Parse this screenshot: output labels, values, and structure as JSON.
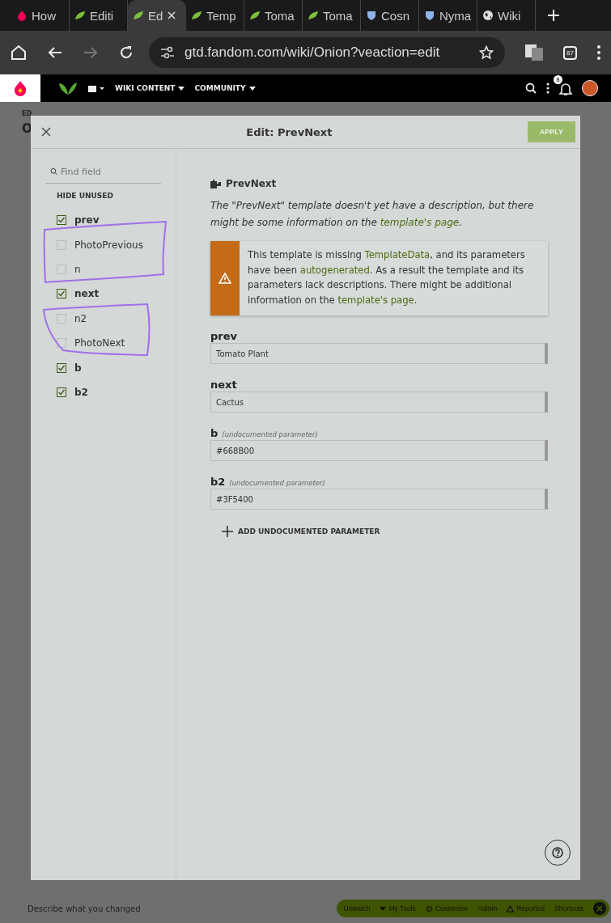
{
  "browser": {
    "tabs": [
      {
        "title": "How",
        "kind": "flame",
        "selected": false
      },
      {
        "title": "Editi",
        "kind": "leaf",
        "selected": false
      },
      {
        "title": "Ed",
        "kind": "leaf",
        "selected": true
      },
      {
        "title": "Temp",
        "kind": "leaf",
        "selected": false
      },
      {
        "title": "Toma",
        "kind": "leaf",
        "selected": false
      },
      {
        "title": "Toma",
        "kind": "leaf",
        "selected": false
      },
      {
        "title": "Cosn",
        "kind": "shield",
        "selected": false
      },
      {
        "title": "Nyma",
        "kind": "shield",
        "selected": false
      },
      {
        "title": "Wiki",
        "kind": "globe",
        "selected": false
      }
    ],
    "url": "gtd.fandom.com/wiki/Onion?veaction=edit",
    "extensions_badge": "87"
  },
  "site_nav": {
    "items": [
      "WIKI CONTENT",
      "COMMUNITY"
    ],
    "notification_count": "8"
  },
  "background_page": {
    "label": "ED",
    "heading": "O",
    "summary_placeholder": "Describe what you changed"
  },
  "dialog": {
    "title": "Edit: PrevNext",
    "apply": "APPLY",
    "sidebar": {
      "search_placeholder": "Find field",
      "hide_unused": "HIDE UNUSED",
      "fields": [
        {
          "label": "prev",
          "checked": true
        },
        {
          "label": "PhotoPrevious",
          "checked": false
        },
        {
          "label": "n",
          "checked": false
        },
        {
          "label": "next",
          "checked": true
        },
        {
          "label": "n2",
          "checked": false
        },
        {
          "label": "PhotoNext",
          "checked": false
        },
        {
          "label": "b",
          "checked": true
        },
        {
          "label": "b2",
          "checked": true
        }
      ]
    },
    "template": {
      "name": "PrevNext",
      "description": "The \"PrevNext\" template doesn't yet have a description, but there might be some information on the ",
      "description_link": "template's page",
      "description_end": "."
    },
    "notice": {
      "parts": [
        {
          "text": "This template is missing ",
          "link": false
        },
        {
          "text": "TemplateData",
          "link": true
        },
        {
          "text": ", and its parameters have been ",
          "link": false
        },
        {
          "text": "autogenerated",
          "link": true
        },
        {
          "text": ". As a result the template and its parameters lack descriptions. There might be additional information on the ",
          "link": false
        },
        {
          "text": "template's page",
          "link": true
        },
        {
          "text": ".",
          "link": false
        }
      ]
    },
    "params": [
      {
        "name": "prev",
        "value": "Tomato Plant"
      },
      {
        "name": "next",
        "value": "Cactus"
      },
      {
        "name": "b",
        "note": "(undocumented parameter)",
        "value": "#668B00"
      },
      {
        "name": "b2",
        "note": "(undocumented parameter)",
        "value": "#3F5400"
      }
    ],
    "add_param": "ADD UNDOCUMENTED PARAMETER"
  },
  "admin_toolbar": {
    "items": [
      "Unwatch",
      "My Tools",
      "Customize",
      "Admin",
      "Reported",
      "Shortcuts"
    ]
  }
}
